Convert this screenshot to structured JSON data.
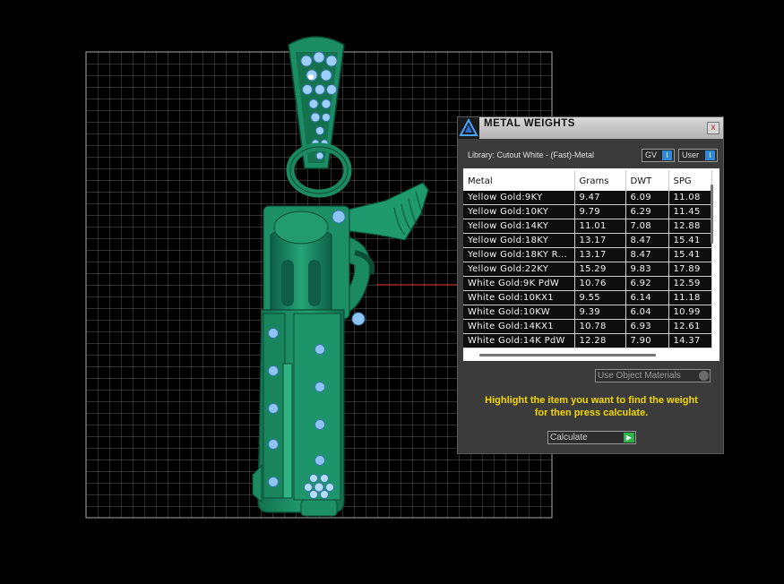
{
  "dialog": {
    "title": "METAL WEIGHTS",
    "close_label": "x",
    "library_label": "Library: Cutout White - (Fast)-Metal",
    "gv_toggle": "GV",
    "user_toggle": "User",
    "toggle_indicator": "I",
    "use_materials_label": "Use Object Materials",
    "hint_line1": "Highlight the item you want to find the weight",
    "hint_line2": "for then press calculate.",
    "calc_label": "Calculate",
    "calc_arrow": "▶"
  },
  "table": {
    "columns": [
      "Metal",
      "Grams",
      "DWT",
      "SPG"
    ],
    "rows": [
      [
        "Yellow Gold:9KY",
        "9.47",
        "6.09",
        "11.08"
      ],
      [
        "Yellow Gold:10KY",
        "9.79",
        "6.29",
        "11.45"
      ],
      [
        "Yellow Gold:14KY",
        "11.01",
        "7.08",
        "12.88"
      ],
      [
        "Yellow Gold:18KY",
        "13.17",
        "8.47",
        "15.41"
      ],
      [
        "Yellow Gold:18KY R...",
        "13.17",
        "8.47",
        "15.41"
      ],
      [
        "Yellow Gold:22KY",
        "15.29",
        "9.83",
        "17.89"
      ],
      [
        "White Gold:9K PdW",
        "10.76",
        "6.92",
        "12.59"
      ],
      [
        "White Gold:10KX1",
        "9.55",
        "6.14",
        "11.18"
      ],
      [
        "White Gold:10KW",
        "9.39",
        "6.04",
        "10.99"
      ],
      [
        "White Gold:14KX1",
        "10.78",
        "6.93",
        "12.61"
      ],
      [
        "White Gold:14K PdW",
        "12.28",
        "7.90",
        "14.37"
      ]
    ]
  },
  "colors": {
    "model_green": "#1b8a63",
    "hint_yellow": "#f5d800",
    "stone_blue": "#8ec4f2"
  }
}
